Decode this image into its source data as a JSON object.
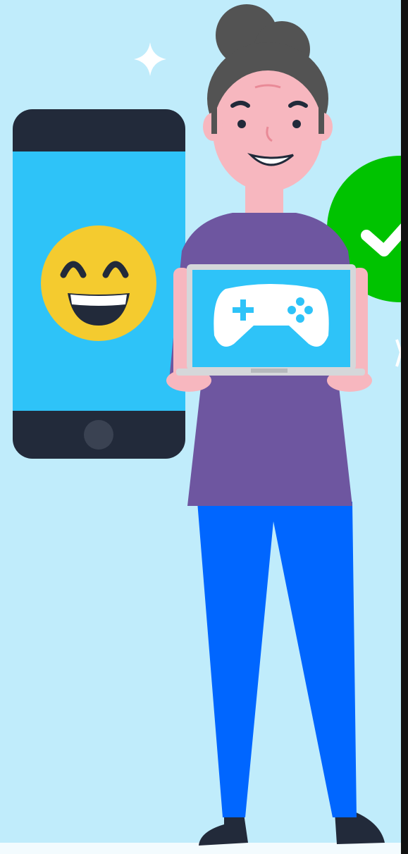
{
  "colors": {
    "background": "#c0ecfb",
    "phone_body": "#222a3a",
    "phone_screen": "#2ec3f8",
    "emoji_yellow": "#f4cb2f",
    "shirt": "#6e56a0",
    "pants": "#0066ff",
    "skin": "#f7b7bf",
    "hair": "#535353",
    "check_badge": "#00c300",
    "laptop_screen": "#2ec3f8",
    "laptop_frame": "#d5d7da",
    "shoes": "#222a3a",
    "sparkle": "#ffffff",
    "right_edge": "#111111"
  },
  "icons": {
    "phone": "smartphone-icon",
    "emoji": "grinning-face-icon",
    "laptop": "laptop-icon",
    "gamepad": "gamepad-icon",
    "badge": "checkmark-badge-icon",
    "sparkle": "sparkle-icon"
  }
}
